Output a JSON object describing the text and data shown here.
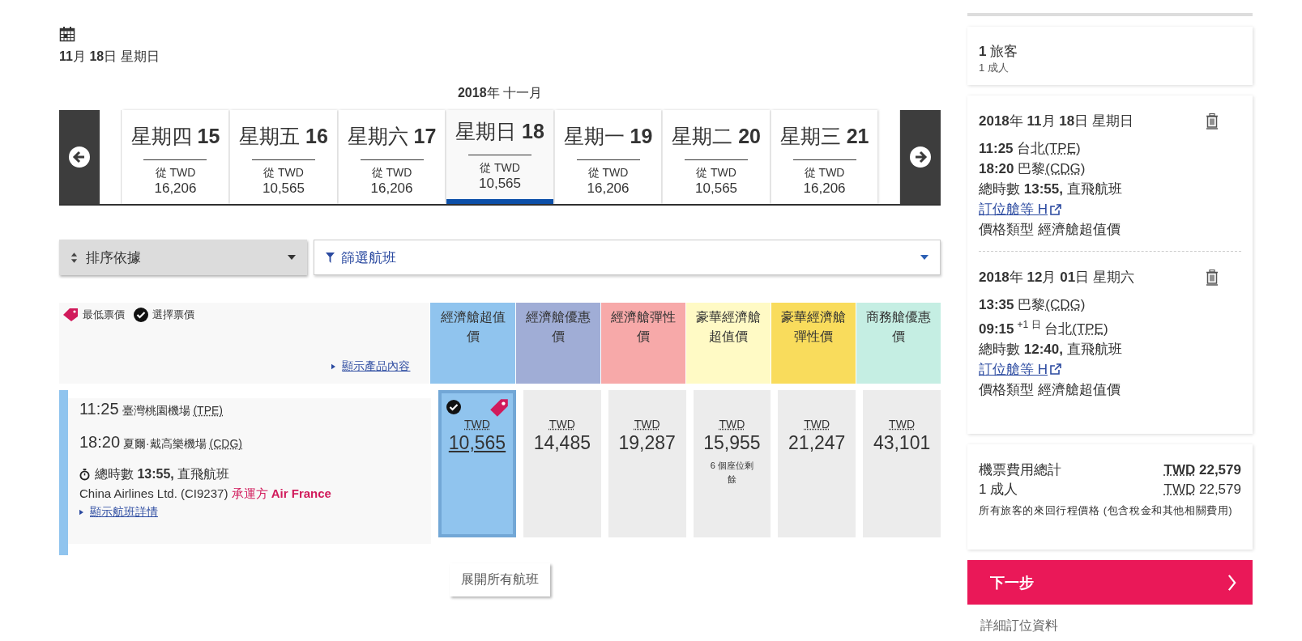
{
  "selected_date": "**11**月 **18**日 星期日",
  "calendar": {
    "month": "**2018**年 十一月",
    "days": [
      {
        "weekday": "星期四",
        "day": "15",
        "from": "從 TWD",
        "price": "16,206",
        "selected": false
      },
      {
        "weekday": "星期五",
        "day": "16",
        "from": "從 TWD",
        "price": "10,565",
        "selected": false
      },
      {
        "weekday": "星期六",
        "day": "17",
        "from": "從 TWD",
        "price": "16,206",
        "selected": false
      },
      {
        "weekday": "星期日",
        "day": "18",
        "from": "從 TWD",
        "price": "10,565",
        "selected": true
      },
      {
        "weekday": "星期一",
        "day": "19",
        "from": "從 TWD",
        "price": "16,206",
        "selected": false
      },
      {
        "weekday": "星期二",
        "day": "20",
        "from": "從 TWD",
        "price": "10,565",
        "selected": false
      },
      {
        "weekday": "星期三",
        "day": "21",
        "from": "從 TWD",
        "price": "16,206",
        "selected": false
      }
    ]
  },
  "sort": {
    "label": "排序依據"
  },
  "filter": {
    "label": "篩選航班"
  },
  "legend": [
    {
      "kind": "tag",
      "label": "最低票價"
    },
    {
      "kind": "check",
      "label": "選擇票價"
    }
  ],
  "show_product_link": "顯示產品內容",
  "fare_columns": [
    {
      "label": "經濟艙超值價",
      "color": "#90c4ee"
    },
    {
      "label": "經濟艙優惠價",
      "color": "#a0add6"
    },
    {
      "label": "經濟艙彈性價",
      "color": "#f7a9a9"
    },
    {
      "label": "豪華經濟艙超值價",
      "color": "#fffac5"
    },
    {
      "label": "豪華經濟艙彈性價",
      "color": "#f9dc5c"
    },
    {
      "label": "商務艙優惠價",
      "color": "#c5eee3"
    }
  ],
  "flight": {
    "departure_time": "11:25",
    "departure_airport": "臺灣桃園機場",
    "departure_code": "(TPE)",
    "arrival_time": "18:20",
    "arrival_airport": "夏爾·戴高樂機場",
    "arrival_code": "(CDG)",
    "duration": "總時數 **13:55,** 直飛航班",
    "airline": "China Airlines Ltd. (CI9237)",
    "operated_by": "承運方",
    "operator": "Air France",
    "details_link": "顯示航班詳情",
    "fares": [
      {
        "currency": "TWD",
        "price": "10,565",
        "selected": true,
        "lowest": true
      },
      {
        "currency": "TWD",
        "price": "14,485",
        "selected": false,
        "lowest": false
      },
      {
        "currency": "TWD",
        "price": "19,287",
        "selected": false,
        "lowest": false
      },
      {
        "currency": "TWD",
        "price": "15,955",
        "selected": false,
        "lowest": false,
        "note": "6 個座位剩餘"
      },
      {
        "currency": "TWD",
        "price": "21,247",
        "selected": false,
        "lowest": false
      },
      {
        "currency": "TWD",
        "price": "43,101",
        "selected": false,
        "lowest": false
      }
    ]
  },
  "expand_button": "展開所有航班",
  "sidebar": {
    "passengers": {
      "count": "1",
      "label": "旅客",
      "detail": "1 成人"
    },
    "segments": [
      {
        "date": "**2018**年 **11**月 **18**日 星期日",
        "departure_time": "11:25",
        "departure_city": "台北",
        "departure_code": "(TPE)",
        "arrival_time": "18:20",
        "arrival_city": "巴黎",
        "arrival_code": "(CDG)",
        "duration": "總時數 **13:55,** 直飛航班",
        "class_link": "訂位艙等 H",
        "fare_type": "價格類型 經濟艙超值價"
      },
      {
        "date": "**2018**年 **12**月 **01**日 星期六",
        "departure_time": "13:35",
        "departure_city": "巴黎",
        "departure_code": "(CDG)",
        "arrival_time": "09:15",
        "arrival_offset": "+1 日",
        "arrival_city": "台北",
        "arrival_code": "(TPE)",
        "duration": "總時數 **12:40,** 直飛航班",
        "class_link": "訂位艙等 H",
        "fare_type": "價格類型 經濟艙超值價"
      }
    ],
    "total": {
      "label": "機票費用總計",
      "currency": "TWD",
      "amount": "22,579",
      "adult_label": "1 成人",
      "adult_currency": "TWD",
      "adult_amount": "22,579",
      "note": "所有旅客的來回行程價格 (包含稅金和其他相關費用)"
    },
    "next_button": "下一步",
    "details_link": "詳細訂位資料"
  }
}
